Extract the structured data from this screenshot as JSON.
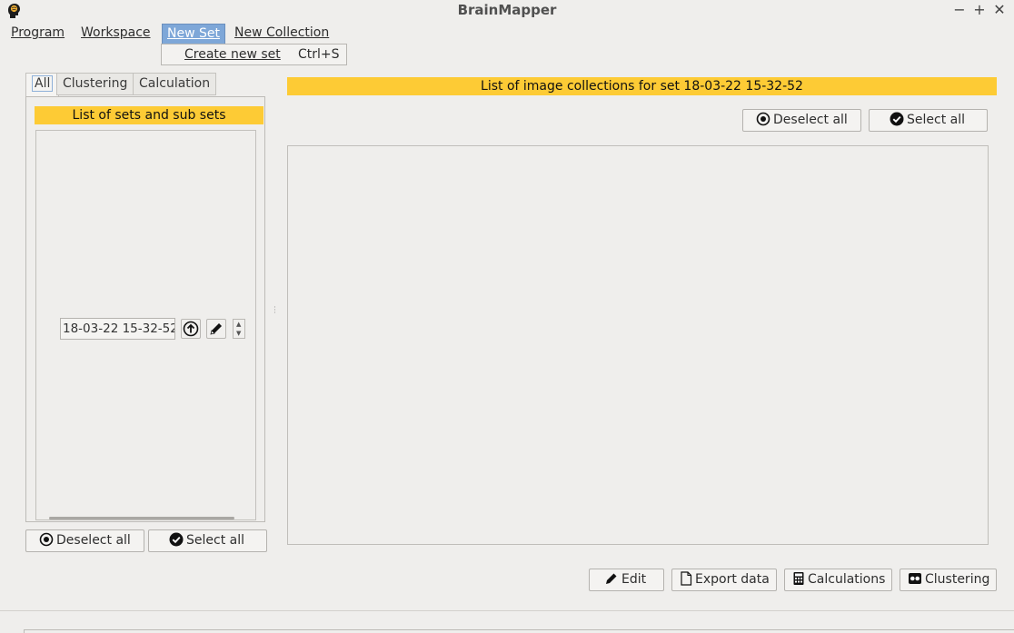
{
  "window": {
    "title": "BrainMapper",
    "minimize_glyph": "−",
    "maximize_glyph": "+",
    "close_glyph": "✕"
  },
  "menubar": {
    "program": "Program",
    "workspace": "Workspace",
    "new_set": "New Set",
    "new_collection": "New Collection"
  },
  "dropdown": {
    "create_new_set": "Create new set",
    "shortcut": "Ctrl+S"
  },
  "tabs": {
    "all": "All",
    "clustering": "Clustering",
    "calculation": "Calculation"
  },
  "left_panel": {
    "header": "List of sets and sub sets",
    "set_name": "18-03-22 15-32-52",
    "deselect_all": "Deselect all",
    "select_all": "Select all"
  },
  "main": {
    "header": "List of image collections for set 18-03-22 15-32-52",
    "deselect_all": "Deselect all",
    "select_all": "Select all"
  },
  "bottom_buttons": {
    "edit": "Edit",
    "export_data": "Export data",
    "calculations": "Calculations",
    "clustering": "Clustering"
  },
  "colors": {
    "header_yellow": "#fdcb35",
    "menu_active": "#7ea7d8",
    "window_bg": "#efeeec"
  },
  "icons": {
    "app": "brain-head-icon",
    "deselect": "radio-dot-icon",
    "select": "check-circle-icon",
    "up": "arrow-up-circle-icon",
    "edit": "pencil-icon",
    "export": "file-icon",
    "calculations": "calculator-icon",
    "clustering": "cluster-icon"
  }
}
